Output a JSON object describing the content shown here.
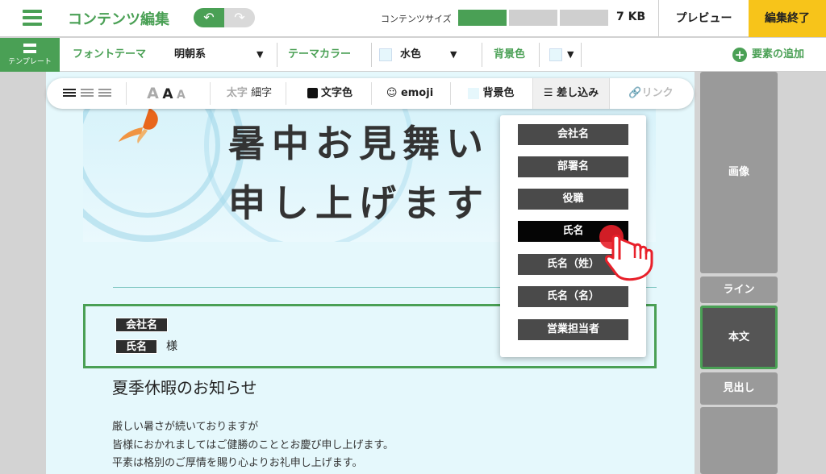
{
  "header": {
    "title": "コンテンツ編集",
    "size_label": "コンテンツサイズ",
    "size_value": "7 KB",
    "size_fill_segments": 1,
    "size_total_segments": 3,
    "preview_label": "プレビュー",
    "finish_label": "編集終了"
  },
  "subbar": {
    "template_label": "テンプレート",
    "font_theme_label": "フォントテーマ",
    "font_theme_value": "明朝系",
    "theme_color_label": "テーマカラー",
    "theme_color_value": "水色",
    "bg_color_label": "背景色",
    "add_element_label": "要素の追加"
  },
  "toolbar": {
    "bold_label": "太字",
    "thin_label": "細字",
    "text_color_label": "文字色",
    "emoji_label": "emoji",
    "bg_color_label": "背景色",
    "insert_label": "差し込み",
    "link_label": "リンク",
    "font_size_glyph": "A"
  },
  "hero": {
    "line1": "暑中お見舞い",
    "line2": "申し上げます"
  },
  "namebox": {
    "company_tag": "会社名",
    "name_tag": "氏名",
    "honorific": "様"
  },
  "body": {
    "heading": "夏季休暇のお知らせ",
    "lines": [
      "厳しい暑さが続いておりますが",
      "皆様におかれましてはご健勝のこととお慶び申し上げます。",
      "平素は格別のご厚情を賜り心よりお礼申し上げます。"
    ]
  },
  "insert_menu": {
    "items": [
      "会社名",
      "部署名",
      "役職",
      "氏名",
      "氏名（姓）",
      "氏名（名）",
      "営業担当者"
    ],
    "selected_index": 3
  },
  "right_panel": {
    "image": "画像",
    "line": "ライン",
    "body_text": "本文",
    "heading": "見出し"
  },
  "colors": {
    "accent_green": "#4aa055",
    "finish_yellow": "#f7c41a",
    "cursor_red": "#e8202a"
  }
}
